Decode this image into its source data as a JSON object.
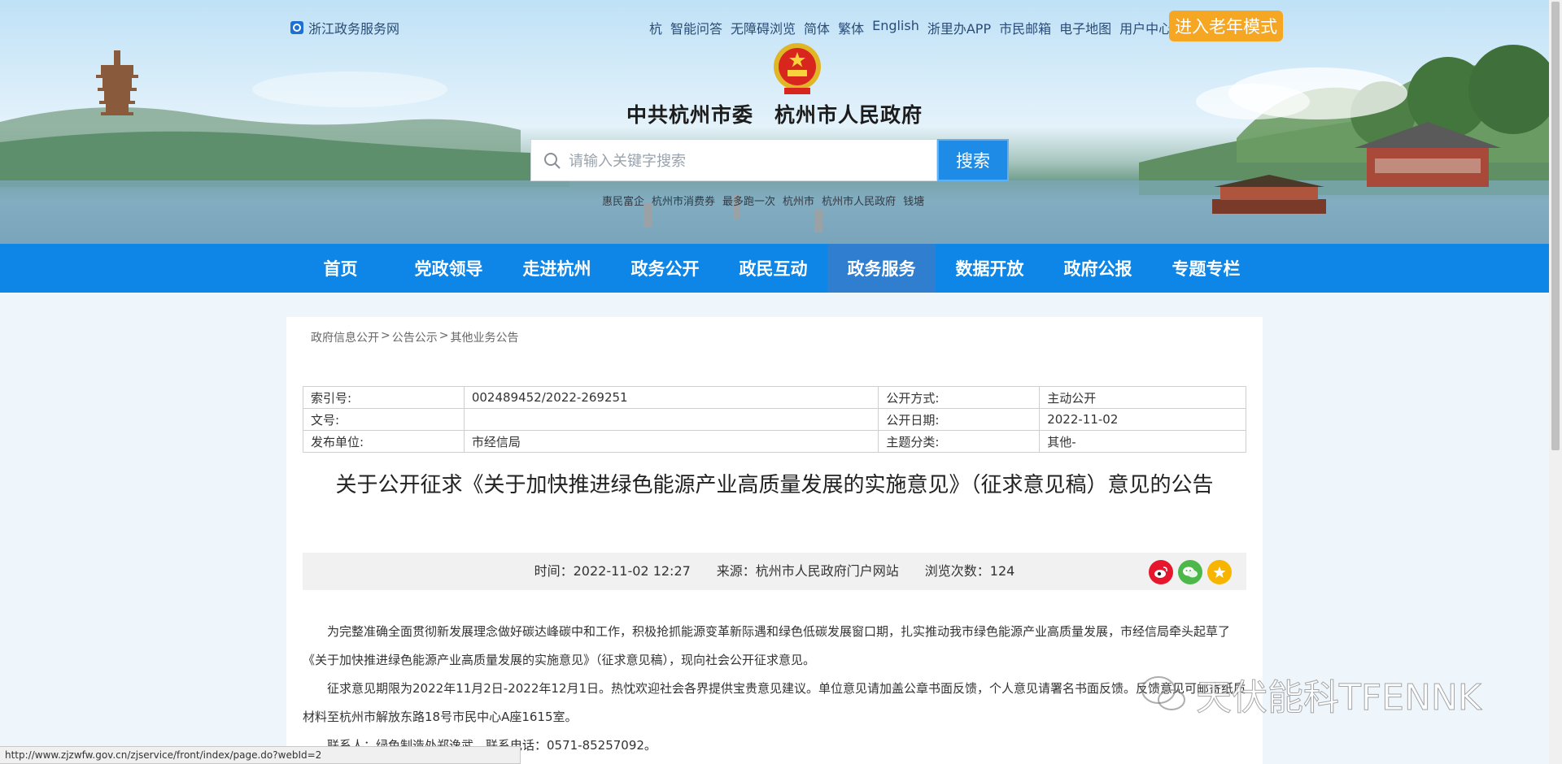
{
  "header": {
    "site_link": "浙江政务服务网",
    "top_links": [
      "杭",
      "智能问答",
      "无障碍浏览",
      "简体",
      "繁体",
      "English",
      "浙里办APP",
      "市民邮箱",
      "电子地图",
      "用户中心"
    ],
    "elder_mode": "进入老年模式",
    "gov_title": "中共杭州市委　杭州市人民政府",
    "search_placeholder": "请输入关键字搜索",
    "search_button": "搜索",
    "hot_words": [
      "惠民富企",
      "杭州市消费券",
      "最多跑一次",
      "杭州市",
      "杭州市人民政府",
      "钱塘"
    ]
  },
  "nav": {
    "items": [
      "首页",
      "党政领导",
      "走进杭州",
      "政务公开",
      "政民互动",
      "政务服务",
      "数据开放",
      "政府公报",
      "专题专栏"
    ],
    "active_index": 5
  },
  "breadcrumb": [
    "政府信息公开",
    ">",
    "公告公示",
    ">",
    "其他业务公告"
  ],
  "meta": {
    "rows": [
      [
        "索引号:",
        "002489452/2022-269251",
        "公开方式:",
        "主动公开"
      ],
      [
        "文号:",
        "",
        "公开日期:",
        "2022-11-02"
      ],
      [
        "发布单位:",
        "市经信局",
        "主题分类:",
        "其他-"
      ]
    ]
  },
  "article": {
    "title": "关于公开征求《关于加快推进绿色能源产业高质量发展的实施意见》（征求意见稿）意见的公告",
    "info": "时间：2022-11-02 12:27　　来源：杭州市人民政府门户网站　　浏览次数：124",
    "paragraphs": [
      "为完整准确全面贯彻新发展理念做好碳达峰碳中和工作，积极抢抓能源变革新际遇和绿色低碳发展窗口期，扎实推动我市绿色能源产业高质量发展，市经信局牵头起草了《关于加快推进绿色能源产业高质量发展的实施意见》（征求意见稿），现向社会公开征求意见。",
      "征求意见期限为2022年11月2日-2022年12月1日。热忱欢迎社会各界提供宝贵意见建议。单位意见请加盖公章书面反馈，个人意见请署名书面反馈。反馈意见可邮寄纸质材料至杭州市解放东路18号市民中心A座1615室。",
      "联系人：绿色制造处郑逸武，联系电话：0571-85257092。"
    ]
  },
  "watermark": "天伏能科TFENNK",
  "status_bar": "http://www.zjzwfw.gov.cn/zjservice/front/index/page.do?webId=2",
  "colors": {
    "nav_bg": "#0d86e8",
    "nav_active": "#2f7ed0",
    "elder_btn": "#f5a623",
    "search_btn": "#1e8be6"
  }
}
